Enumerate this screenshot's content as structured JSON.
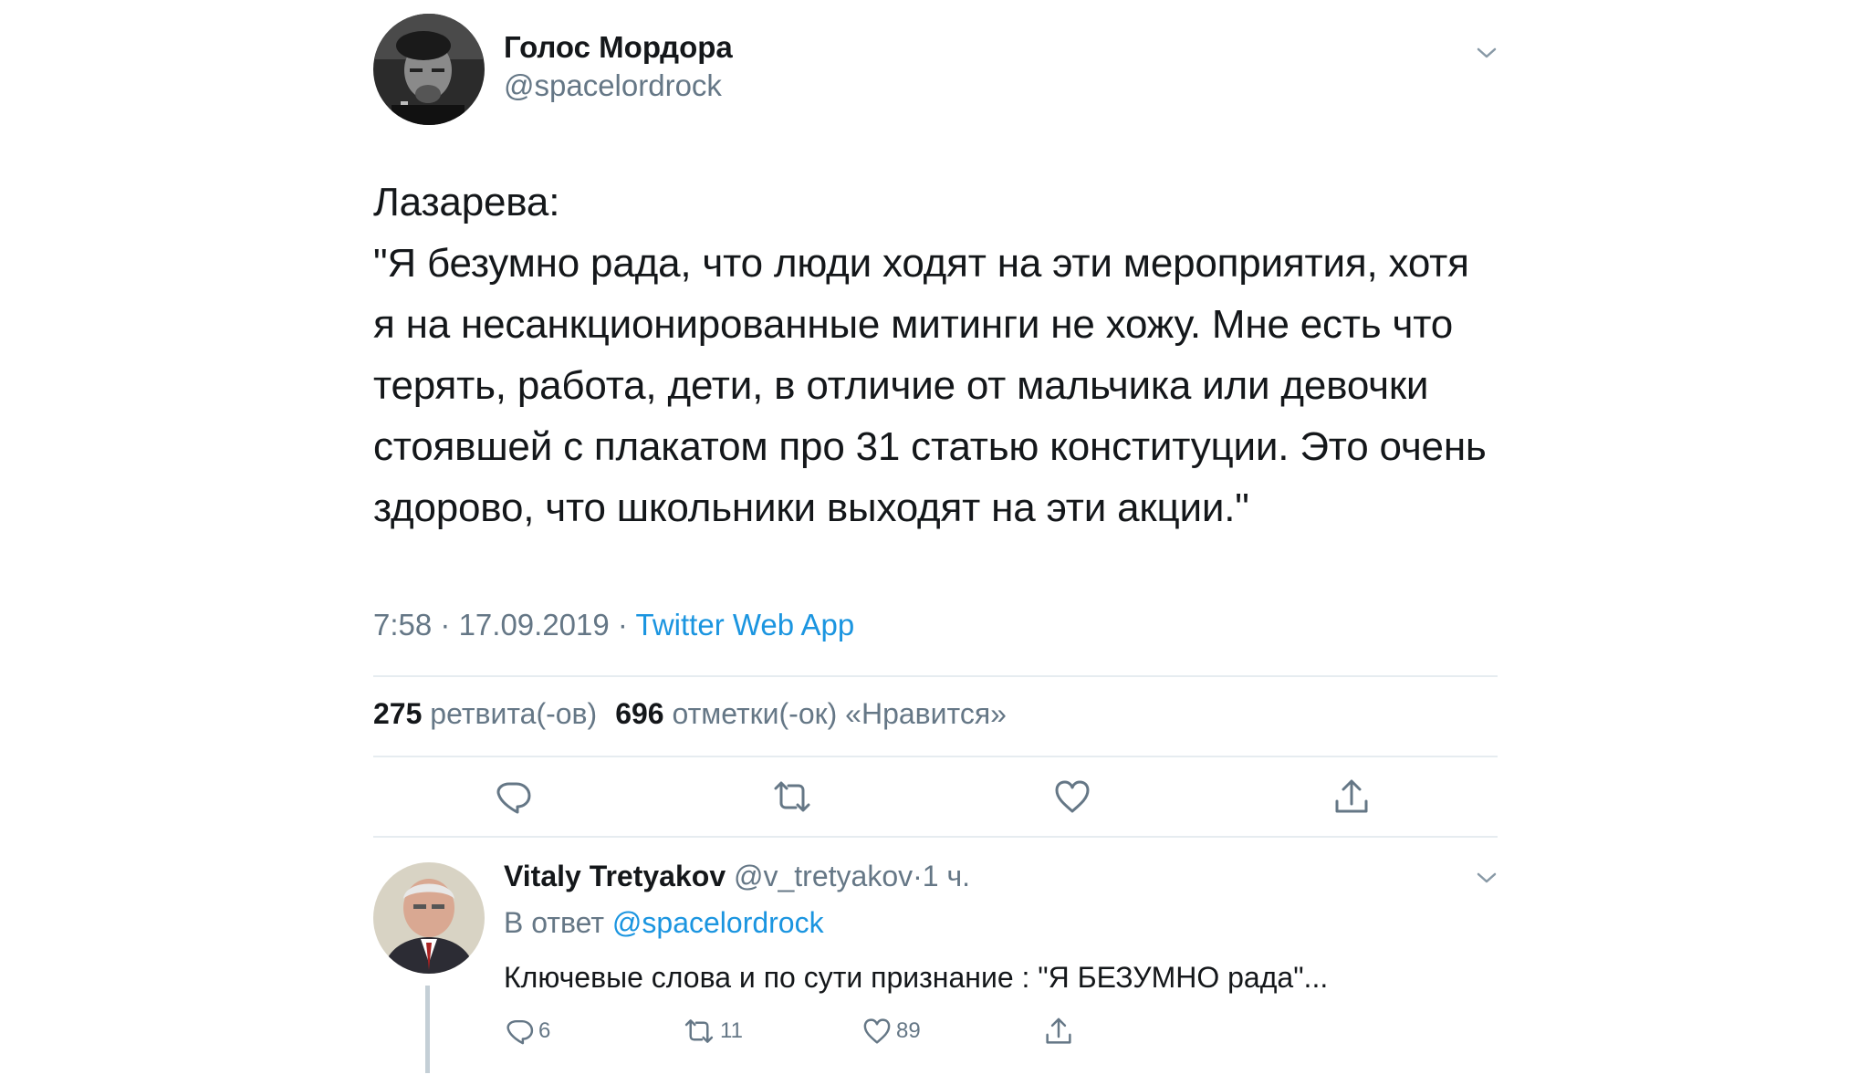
{
  "tweet": {
    "author_name": "Голос Мордора",
    "author_handle": "@spacelordrock",
    "text": "Лазарева:\n\"Я безумно рада, что люди ходят на эти мероприятия, хотя я на несанкционированные митинги не хожу. Мне есть что терять, работа, дети, в отличие от мальчика или девочки стоявшей с плакатом про 31 статью конституции. Это очень здорово, что школьники выходят на эти акции.\"",
    "time": "7:58",
    "date": "17.09.2019",
    "separator": "·",
    "source": "Twitter Web App",
    "retweet_count": "275",
    "retweet_label": "ретвита(-ов)",
    "like_count": "696",
    "like_label": "отметки(-ок) «Нравится»"
  },
  "reply": {
    "author_name": "Vitaly Tretyakov",
    "author_handle": "@v_tretyakov",
    "time_ago": "1 ч.",
    "reply_prefix": "В ответ",
    "reply_mention": "@spacelordrock",
    "text": "Ключевые слова и по сути признание : \"Я БЕЗУМНО рада\"...",
    "reply_count": "6",
    "retweet_count": "11",
    "like_count": "89"
  },
  "colors": {
    "text": "#14171a",
    "secondary": "#657786",
    "link": "#1b95e0",
    "divider": "#e6ecf0"
  },
  "icons": [
    "chevron-down-icon",
    "reply-icon",
    "retweet-icon",
    "heart-icon",
    "share-icon"
  ]
}
